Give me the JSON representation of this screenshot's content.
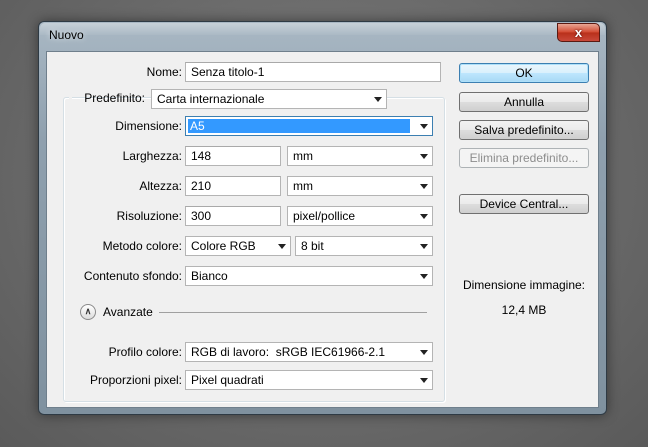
{
  "window": {
    "title": "Nuovo",
    "close_glyph": "x",
    "close_icon": "close-icon"
  },
  "form": {
    "nome": {
      "label": "Nome:",
      "value": "Senza titolo-1"
    },
    "predefinito": {
      "label": "Predefinito:",
      "value": "Carta internazionale"
    },
    "dimensione": {
      "label": "Dimensione:",
      "value": "A5"
    },
    "larghezza": {
      "label": "Larghezza:",
      "value": "148",
      "unit": "mm"
    },
    "altezza": {
      "label": "Altezza:",
      "value": "210",
      "unit": "mm"
    },
    "risoluzione": {
      "label": "Risoluzione:",
      "value": "300",
      "unit": "pixel/pollice"
    },
    "metodo_colore": {
      "label": "Metodo colore:",
      "mode": "Colore RGB",
      "depth": "8 bit"
    },
    "contenuto_sfondo": {
      "label": "Contenuto sfondo:",
      "value": "Bianco"
    },
    "avanzate": {
      "label": "Avanzate",
      "toggle_glyph": "∧",
      "icon": "collapse-chevrons-icon"
    },
    "profilo_colore": {
      "label": "Profilo colore:",
      "value": "RGB di lavoro:  sRGB IEC61966-2.1"
    },
    "proporzioni_pixel": {
      "label": "Proporzioni pixel:",
      "value": "Pixel quadrati"
    }
  },
  "buttons": {
    "ok": "OK",
    "annulla": "Annulla",
    "salva_predefinito": "Salva predefinito...",
    "elimina_predefinito": "Elimina predefinito...",
    "device_central": "Device Central..."
  },
  "image_size": {
    "label": "Dimensione immagine:",
    "value": "12,4 MB"
  },
  "colors": {
    "selection": "#3399ff",
    "default_button_border": "#3c7fb1",
    "close_button": "#c9493a",
    "dialog_face": "#f0f0f0"
  }
}
